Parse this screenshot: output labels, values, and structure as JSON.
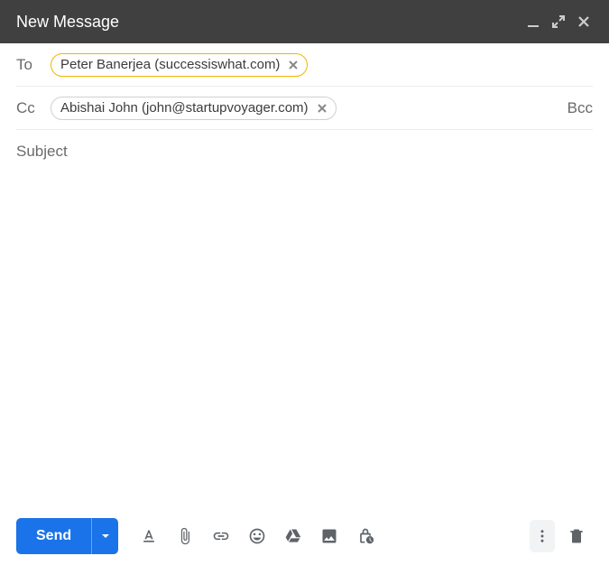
{
  "window": {
    "title": "New Message"
  },
  "fields": {
    "to_label": "To",
    "cc_label": "Cc",
    "bcc_label": "Bcc",
    "to_chip": "Peter Banerjea (successiswhat.com)",
    "cc_chip": "Abishai John (john@startupvoyager.com)",
    "subject_placeholder": "Subject",
    "subject_value": "",
    "body_value": ""
  },
  "toolbar": {
    "send_label": "Send"
  }
}
